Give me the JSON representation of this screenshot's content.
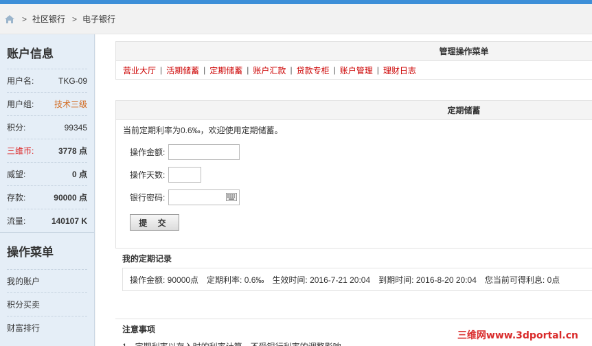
{
  "breadcrumb": {
    "sep1": ">",
    "item1": "社区银行",
    "sep2": ">",
    "item2": "电子银行"
  },
  "sidebar": {
    "account_title": "账户信息",
    "rows": [
      {
        "k": "用户名:",
        "v": "TKG-09"
      },
      {
        "k": "用户组:",
        "v": "技术三级"
      },
      {
        "k": "积分:",
        "v": "99345"
      },
      {
        "k": "三维币:",
        "v": "3778 点"
      },
      {
        "k": "威望:",
        "v": "0 点"
      },
      {
        "k": "存款:",
        "v": "90000 点"
      },
      {
        "k": "流量:",
        "v": "140107 K"
      }
    ],
    "menu_title": "操作菜单",
    "menu": [
      "我的账户",
      "积分买卖",
      "财富排行"
    ]
  },
  "manage": {
    "title": "管理操作菜单",
    "links": [
      "营业大厅",
      "活期储蓄",
      "定期储蓄",
      "账户汇款",
      "贷款专柜",
      "账户管理",
      "理财日志"
    ]
  },
  "fixed": {
    "title": "定期储蓄",
    "intro": "当前定期利率为0.6‰，欢迎使用定期储蓄。",
    "amount_label": "操作金额:",
    "days_label": "操作天数:",
    "pwd_label": "银行密码:",
    "submit": "提 交"
  },
  "records": {
    "title": "我的定期记录",
    "amount": "操作金额: 90000点",
    "rate": "定期利率: 0.6‰",
    "start": "生效时间: 2016-7-21 20:04",
    "end": "到期时间: 2016-8-20 20:04",
    "interest": "您当前可得利息: 0点"
  },
  "notice": {
    "title": "注意事项",
    "line1": "1、定期利率以存入时的利率计算，不受银行利率的调整影响"
  },
  "watermark": "三维网www.3dportal.cn",
  "colors": {
    "accent": "#3d8fd8",
    "link": "#cc0000",
    "sidebar_bg": "#e5eef7"
  }
}
